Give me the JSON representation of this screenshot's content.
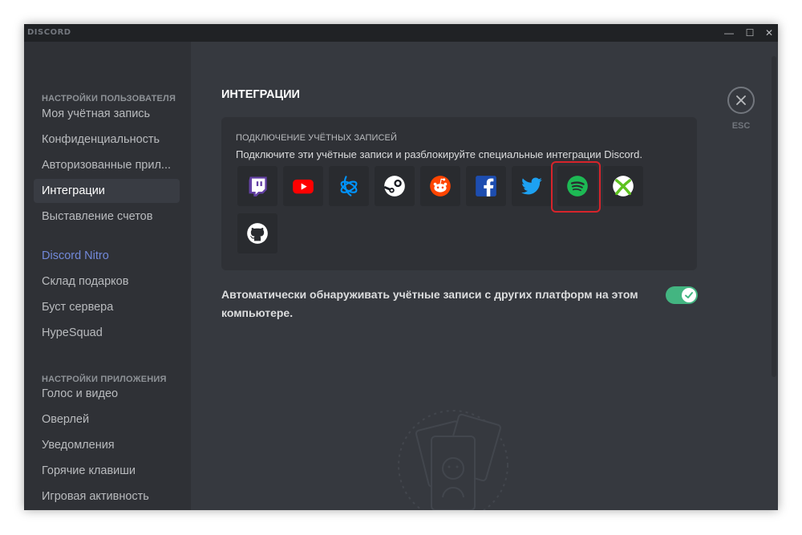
{
  "app": {
    "logo_text": "DISCORD"
  },
  "window_controls": {
    "minimize": "—",
    "maximize": "☐",
    "close": "✕"
  },
  "sidebar": {
    "user_settings_header": "НАСТРОЙКИ ПОЛЬЗОВАТЕЛЯ",
    "user_items": [
      {
        "label": "Моя учётная запись"
      },
      {
        "label": "Конфиденциальность"
      },
      {
        "label": "Авторизованные прил..."
      },
      {
        "label": "Интеграции"
      },
      {
        "label": "Выставление счетов"
      }
    ],
    "nitro_items": [
      {
        "label": "Discord Nitro"
      },
      {
        "label": "Склад подарков"
      },
      {
        "label": "Буст сервера"
      },
      {
        "label": "HypeSquad"
      }
    ],
    "app_settings_header": "НАСТРОЙКИ ПРИЛОЖЕНИЯ",
    "app_items": [
      {
        "label": "Голос и видео"
      },
      {
        "label": "Оверлей"
      },
      {
        "label": "Уведомления"
      },
      {
        "label": "Горячие клавиши"
      },
      {
        "label": "Игровая активность"
      }
    ]
  },
  "main": {
    "title": "ИНТЕГРАЦИИ",
    "connections": {
      "header": "ПОДКЛЮЧЕНИЕ УЧЁТНЫХ ЗАПИСЕЙ",
      "description": "Подключите эти учётные записи и разблокируйте специальные интеграции Discord.",
      "services": [
        {
          "name": "twitch",
          "icon": "twitch-icon",
          "color": "#6441a5"
        },
        {
          "name": "youtube",
          "icon": "youtube-icon",
          "color": "#ff0000"
        },
        {
          "name": "battlenet",
          "icon": "battlenet-icon",
          "color": "#0094ff"
        },
        {
          "name": "steam",
          "icon": "steam-icon",
          "color": "#ffffff"
        },
        {
          "name": "reddit",
          "icon": "reddit-icon",
          "color": "#ff4500"
        },
        {
          "name": "facebook",
          "icon": "facebook-icon",
          "color": "#1d4db0"
        },
        {
          "name": "twitter",
          "icon": "twitter-icon",
          "color": "#1da1f2"
        },
        {
          "name": "spotify",
          "icon": "spotify-icon",
          "color": "#1db954"
        },
        {
          "name": "xbox",
          "icon": "xbox-icon",
          "color": "#5dc21e"
        },
        {
          "name": "github",
          "icon": "github-icon",
          "color": "#ffffff"
        }
      ]
    },
    "auto_detect": {
      "label": "Автоматически обнаруживать учётные записи с других платформ на этом компьютере.",
      "enabled": true
    },
    "close": {
      "label": "ESC"
    }
  },
  "colors": {
    "accent_nitro": "#7289da",
    "toggle_on": "#43b581",
    "highlight_border": "#d7242b"
  }
}
